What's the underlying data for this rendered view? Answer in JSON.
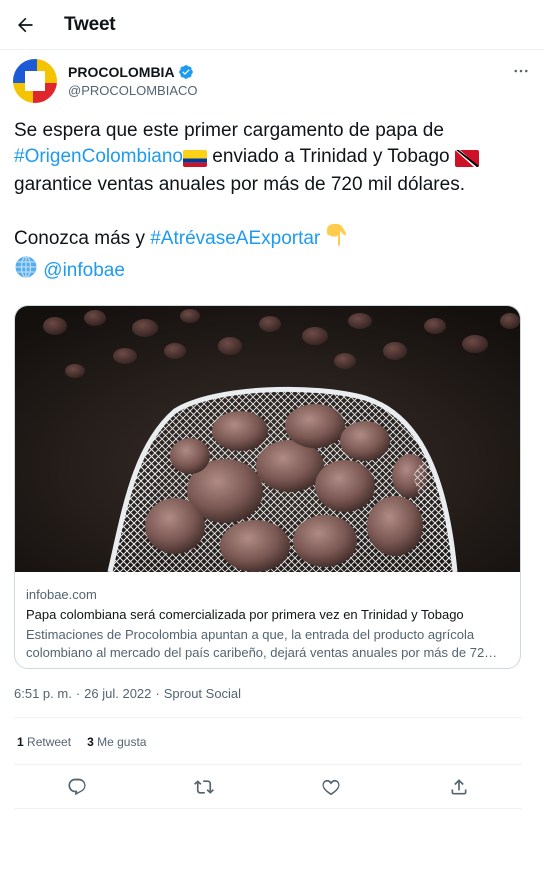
{
  "header": {
    "title": "Tweet",
    "back_icon": "arrow-left-icon"
  },
  "author": {
    "name": "PROCOLOMBIA",
    "handle": "@PROCOLOMBIACO",
    "verified_icon": "verified-badge-icon",
    "avatar_colors": [
      "#1d5bd6",
      "#f5c400",
      "#e0262d"
    ]
  },
  "tweet": {
    "part1": "Se espera que este primer cargamento de papa de ",
    "hashtag1": "#OrigenColombiano",
    "part2": " enviado a Trinidad y Tobago ",
    "part3": " garantice ventas anuales por más de 720 mil dólares.",
    "part4": "Conozca más y ",
    "hashtag2": "#AtrévaseAExportar",
    "mention": "@infobae",
    "emojis": [
      "colombia-flag-icon",
      "trinidad-tobago-flag-icon",
      "pointing-down-icon",
      "globe-icon"
    ]
  },
  "card": {
    "domain": "infobae.com",
    "title": "Papa colombiana será comercializada por primera vez en Trinidad y Tobago",
    "description": "Estimaciones de Procolombia apuntan a que, la entrada del producto agrícola colombiano al mercado del país caribeño, dejará ventas anuales por más de 72…"
  },
  "meta": {
    "time": "6:51 p. m.",
    "separator": "·",
    "date": "26 jul. 2022",
    "source": "Sprout Social"
  },
  "stats": {
    "retweets_count": "1",
    "retweets_label": "Retweet",
    "likes_count": "3",
    "likes_label": "Me gusta"
  },
  "actions": [
    "reply-icon",
    "retweet-icon",
    "like-icon",
    "share-icon"
  ],
  "colors": {
    "link": "#1d9bf0",
    "secondary_text": "#536471",
    "border": "#cfd9de"
  }
}
